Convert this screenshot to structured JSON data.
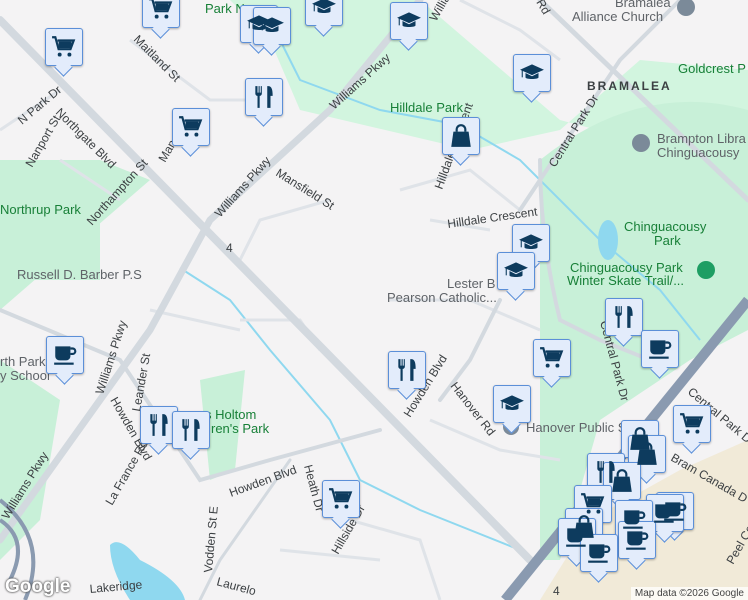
{
  "labels": {
    "park_n": "Park N",
    "maitland": "Maitland St",
    "n_park_dr": "N Park Dr",
    "northgate": "Northgate Blvd",
    "nanport": "Nanport St",
    "mansfield_short": "Mans",
    "northampton": "Northampton St",
    "northrup": "Northrup Park",
    "williams1": "Williams Pkwy",
    "williams2": "Williams Pkwy",
    "williams3": "Williams Pkwy",
    "williams4": "Williams Pkwy",
    "williams_top": "Willia",
    "mansfield": "Mansfield St",
    "route4": "4",
    "route4b": "4",
    "russell": "Russell D. Barber P.S",
    "hilldale_park": "Hilldale Park",
    "hilldale_cres_v": "Hilldale Crescent",
    "hilldale_cres": "Hilldale Crescent",
    "central_park": "Central Park Dr",
    "central_park2": "Central Park Dr",
    "central_park3": "Central Park Dr",
    "bramalea": "BRAMALEA",
    "church1": "Bramalea",
    "church2": "Alliance Church",
    "goldcrest": "Goldcrest P",
    "library1": "Brampton Libra",
    "library2": "Chinguacousy",
    "chin_park1": "Chinguacousy",
    "chin_park2": "Park",
    "skate1": "Chinguacousy Park",
    "skate2": "Winter Skate Trail/...",
    "lester1": "Lester B",
    "lester2": "Pearson Catholic...",
    "rd_top": "Rd",
    "north_park1": "rth Park",
    "north_park2": "y School",
    "leander": "Leander St",
    "howden1": "Howden Blvd",
    "howden2": "Howden Blvd",
    "howden3": "Howden Blvd",
    "holtom1": "s Holtom",
    "holtom2": "ren's Park",
    "la_france": "La France Rd",
    "heath": "Heath Dr",
    "hillside": "Hillside Dr",
    "vodden": "Vodden St E",
    "laurel": "Laurelo",
    "lakeridge": "Lakeridge",
    "hanover_rd": "Hanover Rd",
    "hanover_school": "Hanover Public School",
    "dunlop": "Peel Ce",
    "airport": "Bram Canada D"
  },
  "icons": {
    "cart": "shopping-cart-icon",
    "school": "school-icon",
    "restaurant": "restaurant-icon",
    "bag": "shopping-bag-icon",
    "coffee": "coffee-icon"
  },
  "footer": {
    "logo": "Google",
    "attribution": "Map data ©2026 Google"
  },
  "colors": {
    "marker_fill": "#e3ecfb",
    "marker_border": "#5b8fd8",
    "icon": "#0d3b5e",
    "park": "#c8f0d8",
    "water": "#8fd8ef"
  }
}
